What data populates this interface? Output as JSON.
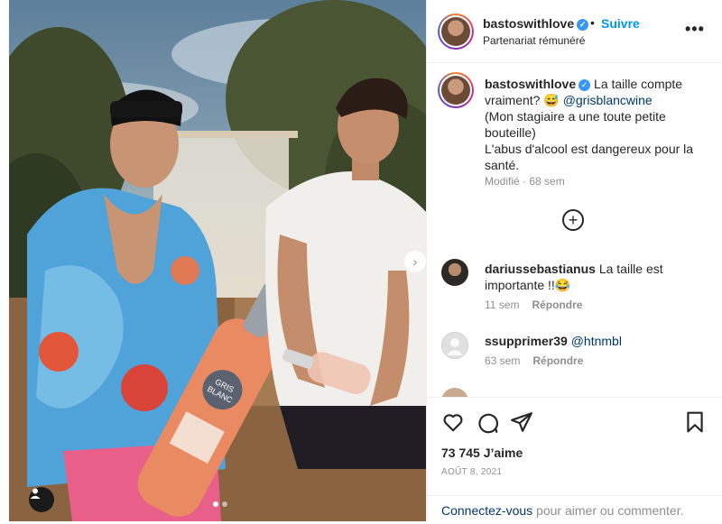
{
  "post": {
    "author": "bastoswithlove",
    "follow_label": "Suivre",
    "separator": "•",
    "subtitle": "Partenariat rémunéré",
    "more_glyph": "•••"
  },
  "caption": {
    "username": "bastoswithlove",
    "text_before_mention": "La taille compte vraiment? 😅 ",
    "mention": "@grisblancwine",
    "line_2": "(Mon stagiaire a une toute petite bouteille)",
    "line_3": "L'abus d'alcool est dangereux pour la santé.",
    "edited_label": "Modifié",
    "meta_separator": " · ",
    "age": "68 sem"
  },
  "load_more_glyph": "+",
  "comments": [
    {
      "username": "dariussebastianus",
      "text": "La taille est importante !!😂",
      "age": "11 sem",
      "reply_label": "Répondre"
    },
    {
      "username": "ssupprimer39",
      "text": "@htnmbl",
      "age": "63 sem",
      "reply_label": "Répondre"
    }
  ],
  "stats": {
    "likes": "73 745 J’aime",
    "date": "AOÛT 8, 2021"
  },
  "footer": {
    "login_link": "Connectez-vous",
    "login_rest": " pour aimer ou commenter."
  },
  "photo": {
    "bottle_brand_line1": "GRIS",
    "bottle_brand_line2": "BLANC"
  },
  "colors": {
    "accent_blue": "#0095f6",
    "link_blue": "#00376b",
    "verified_blue": "#3897f0",
    "muted_gray": "#8e8e8e"
  },
  "icons": [
    "verified-badge-icon",
    "more-options-icon",
    "add-circle-icon",
    "heart-icon",
    "comment-icon",
    "share-icon",
    "bookmark-icon",
    "chevron-right-icon",
    "user-tag-icon"
  ]
}
